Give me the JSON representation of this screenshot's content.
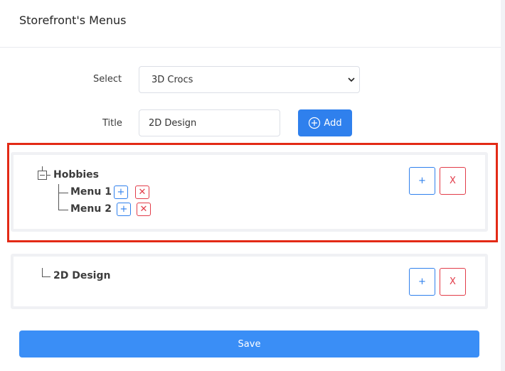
{
  "header": {
    "title": "Storefront's Menus"
  },
  "form": {
    "select_label": "Select",
    "select_value": "3D Crocs",
    "title_label": "Title",
    "title_value": "2D Design",
    "add_label": "Add"
  },
  "menus": [
    {
      "label": "Hobbies",
      "add_symbol": "+",
      "delete_symbol": "X",
      "children": [
        {
          "label": "Menu 1",
          "add_symbol": "+",
          "delete_symbol": "✕"
        },
        {
          "label": "Menu 2",
          "add_symbol": "+",
          "delete_symbol": "✕"
        }
      ]
    },
    {
      "label": "2D Design",
      "add_symbol": "+",
      "delete_symbol": "X",
      "children": []
    }
  ],
  "save_label": "Save",
  "colors": {
    "primary": "#2f80ed",
    "danger": "#e23c49",
    "highlight": "#e32a16",
    "save": "#3a8ef6"
  }
}
